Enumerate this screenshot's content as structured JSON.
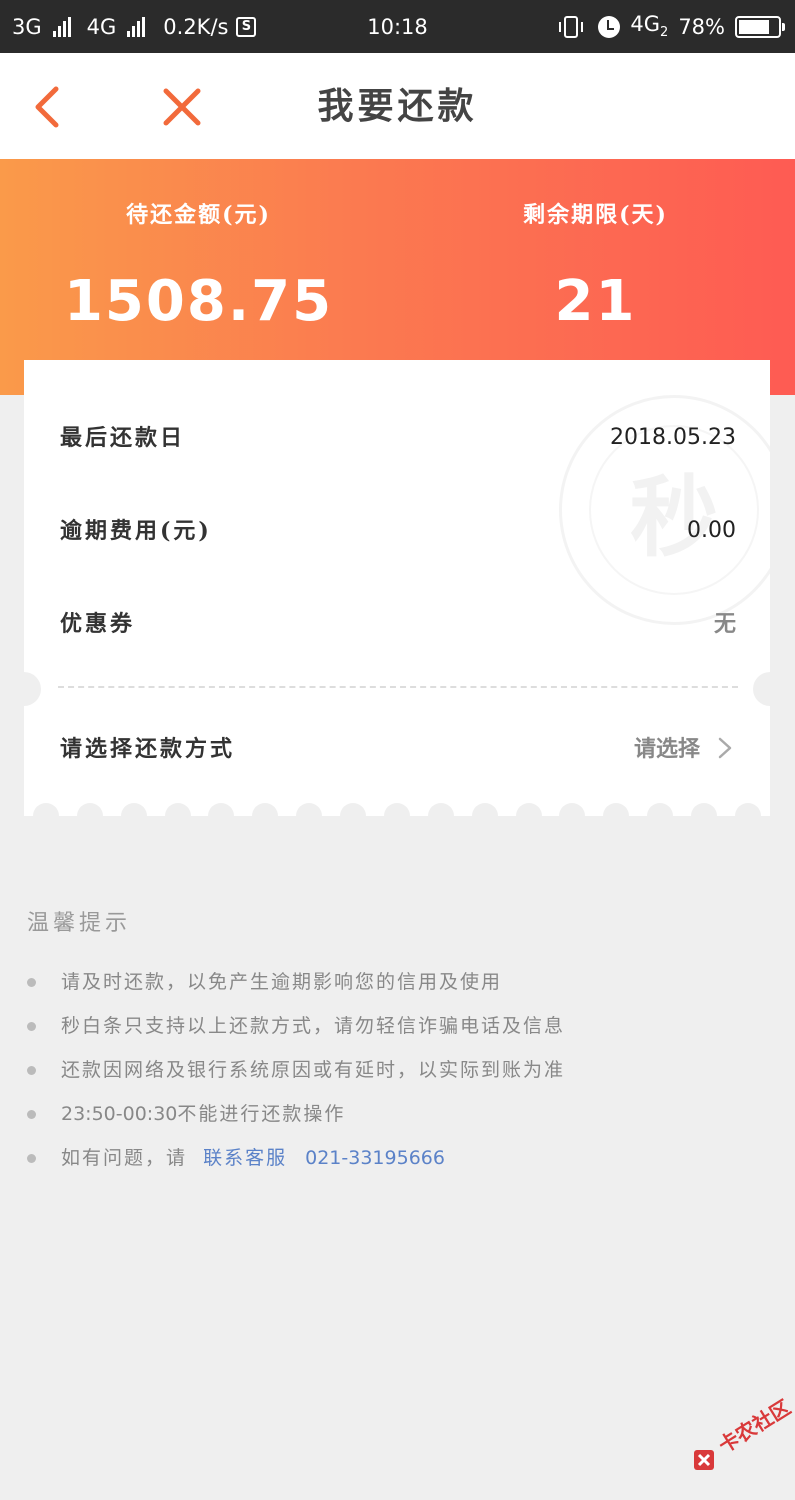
{
  "status_bar": {
    "net1": "3G",
    "net2": "4G",
    "speed": "0.2K/s",
    "speed_icon": "S",
    "time": "10:18",
    "net3": "4G",
    "net3_sub": "2",
    "battery": "78%",
    "battery_level": 0.78
  },
  "nav": {
    "title": "我要还款"
  },
  "summary": {
    "amount_label": "待还金额(元)",
    "amount_value": "1508.75",
    "days_label": "剩余期限(天)",
    "days_value": "21"
  },
  "details": {
    "due_date_label": "最后还款日",
    "due_date_value": "2018.05.23",
    "overdue_label": "逾期费用(元)",
    "overdue_value": "0.00",
    "coupon_label": "优惠券",
    "coupon_value": "无",
    "method_label": "请选择还款方式",
    "method_value": "请选择"
  },
  "stamp_char": "秒",
  "tips": {
    "title": "温馨提示",
    "items": [
      "请及时还款，以免产生逾期影响您的信用及使用",
      "秒白条只支持以上还款方式，请勿轻信诈骗电话及信息",
      "还款因网络及银行系统原因或有延时，以实际到账为准"
    ],
    "time_range": "23:50-00:30",
    "time_text": "不能进行还款操作",
    "contact_prefix": "如有问题，请",
    "contact_link": "联系客服",
    "contact_phone": "021-33195666"
  },
  "watermark": "卡农社区",
  "colors": {
    "accent": "#f26a3b",
    "hero_start": "#fa9a4a",
    "hero_end": "#fe5b53",
    "link": "#5b82c8"
  }
}
